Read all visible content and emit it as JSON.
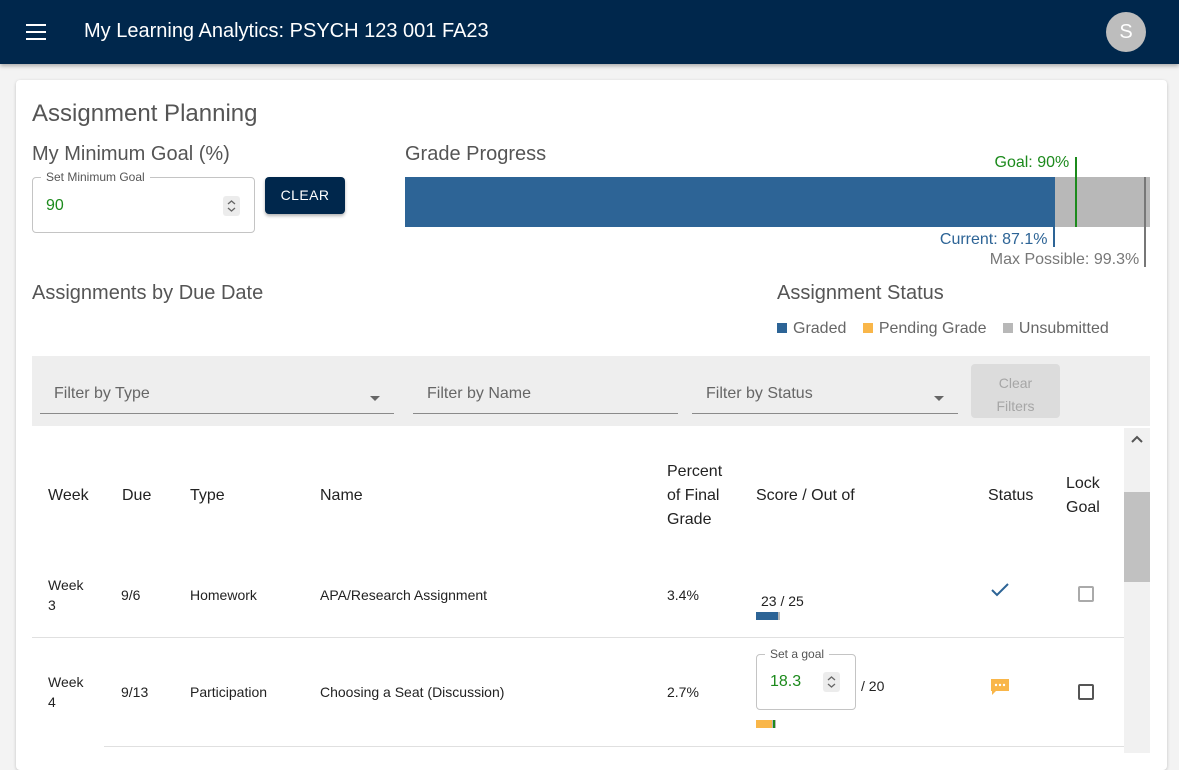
{
  "appbar": {
    "title": "My Learning Analytics:  PSYCH 123 001 FA23",
    "avatar_initial": "S"
  },
  "planning": {
    "title": "Assignment Planning",
    "min_goal_title": "My Minimum Goal (%)",
    "goal_input_label": "Set Minimum Goal",
    "goal_value": "90",
    "clear_label": "CLEAR"
  },
  "grade_progress": {
    "title": "Grade Progress",
    "current_percent": 87.1,
    "goal_percent": 90,
    "max_possible_percent": 99.3,
    "goal_label": "Goal: 90%",
    "current_label": "Current: 87.1%",
    "max_label": "Max Possible: 99.3%",
    "colors": {
      "current": "#2d6496",
      "remaining": "#b8b8b8",
      "goal": "#1c8a1c",
      "max": "#777777"
    }
  },
  "due_date_title": "Assignments by Due Date",
  "status_legend": {
    "title": "Assignment Status",
    "items": [
      {
        "label": "Graded",
        "color": "#2d6496"
      },
      {
        "label": "Pending Grade",
        "color": "#f9b649"
      },
      {
        "label": "Unsubmitted",
        "color": "#b8b8b8"
      }
    ]
  },
  "filters": {
    "type_placeholder": "Filter by Type",
    "name_placeholder": "Filter by Name",
    "status_placeholder": "Filter by Status",
    "clear_line1": "Clear",
    "clear_line2": "Filters"
  },
  "table": {
    "headers": {
      "week": "Week",
      "due": "Due",
      "type": "Type",
      "name": "Name",
      "percent_l1": "Percent",
      "percent_l2": "of Final",
      "percent_l3": "Grade",
      "score": "Score / Out of",
      "status": "Status",
      "lock_l1": "Lock",
      "lock_l2": "Goal"
    },
    "rows": [
      {
        "week_l1": "Week",
        "week_l2": "3",
        "due": "9/6",
        "type": "Homework",
        "name": "APA/Research Assignment",
        "percent": "3.4%",
        "score": "23",
        "out_of": "/ 25",
        "score_fraction": 0.92,
        "status_icon": "check-icon",
        "lock_goal": false
      },
      {
        "week_l1": "Week",
        "week_l2": "4",
        "due": "9/13",
        "type": "Participation",
        "name": "Choosing a Seat (Discussion)",
        "percent": "2.7%",
        "goal_input_label": "Set a goal",
        "goal_value": "18.3",
        "out_of": "/ 20",
        "goal_fraction": 0.915,
        "status_icon": "comment-icon",
        "lock_goal": false
      }
    ]
  }
}
